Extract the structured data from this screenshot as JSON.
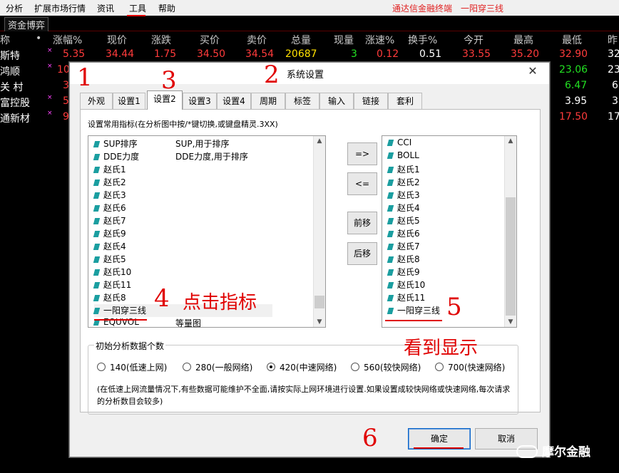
{
  "menu": {
    "items": [
      "分析",
      "扩展市场行情",
      "资讯",
      "工具",
      "帮助"
    ],
    "brand": "通达信金融终端",
    "brand2": "一阳穿三线"
  },
  "tabs": {
    "quote_tab": "资金博弈"
  },
  "quote": {
    "headers": [
      "称",
      "•",
      "涨幅%",
      "现价",
      "涨跌",
      "买价",
      "卖价",
      "总量",
      "现量",
      "涨速%",
      "换手%",
      "今开",
      "最高",
      "最低",
      "昨"
    ],
    "rows": [
      {
        "name": "斯特",
        "mark": "×",
        "chg": "5.35",
        "price": "34.44",
        "diff": "1.75",
        "bid": "34.50",
        "ask": "34.54",
        "vol": "20687",
        "cur": "3",
        "speed": "0.12",
        "turn": "0.51",
        "open": "33.55",
        "high": "35.20",
        "low": "32.90",
        "prev": "32"
      },
      {
        "name": "鸿顺",
        "mark": "×",
        "chg": "10",
        "low": "23.06",
        "prev": "23"
      },
      {
        "name": "关 村",
        "mark": "",
        "chg": "3",
        "low": "6.47",
        "prev": "6"
      },
      {
        "name": "富控股",
        "mark": "×",
        "chg": "5",
        "low": "3.95",
        "prev": "3"
      },
      {
        "name": "通新材",
        "mark": "×",
        "chg": "9",
        "low": "17.50",
        "prev": "17"
      }
    ]
  },
  "dialog": {
    "title": "系统设置",
    "close": "✕",
    "tabs": [
      "外观",
      "设置1",
      "设置2",
      "设置3",
      "设置4",
      "周期",
      "标签",
      "输入",
      "链接",
      "套利"
    ],
    "active_tab": "设置2",
    "hint": "设置常用指标(在分析图中按/*键切换,或键盘精灵.3XX)",
    "left_list": [
      {
        "name": "SUP排序",
        "desc": "SUP,用于排序"
      },
      {
        "name": "DDE力度",
        "desc": "DDE力度,用于排序"
      },
      {
        "name": "赵氏1",
        "desc": ""
      },
      {
        "name": "赵氏2",
        "desc": ""
      },
      {
        "name": "赵氏3",
        "desc": ""
      },
      {
        "name": "赵氏6",
        "desc": ""
      },
      {
        "name": "赵氏7",
        "desc": ""
      },
      {
        "name": "赵氏9",
        "desc": ""
      },
      {
        "name": "赵氏4",
        "desc": ""
      },
      {
        "name": "赵氏5",
        "desc": ""
      },
      {
        "name": "赵氏10",
        "desc": ""
      },
      {
        "name": "赵氏11",
        "desc": ""
      },
      {
        "name": "赵氏8",
        "desc": ""
      },
      {
        "name": "一阳穿三线",
        "desc": ""
      },
      {
        "name": "EQUVOL",
        "desc": "等量图"
      }
    ],
    "right_list": [
      "CCI",
      "BOLL",
      "赵氏1",
      "赵氏2",
      "赵氏3",
      "赵氏4",
      "赵氏5",
      "赵氏6",
      "赵氏7",
      "赵氏8",
      "赵氏9",
      "赵氏10",
      "赵氏11",
      "一阳穿三线"
    ],
    "mid_buttons": [
      "=>",
      "<=",
      "前移",
      "后移"
    ],
    "group_title": "初始分析数据个数",
    "radios": [
      {
        "label": "140(低速上网)",
        "checked": false
      },
      {
        "label": "280(一般网络)",
        "checked": false
      },
      {
        "label": "420(中速网络)",
        "checked": true
      },
      {
        "label": "560(较快网络)",
        "checked": false
      },
      {
        "label": "700(快速网络)",
        "checked": false
      }
    ],
    "note": "(在低速上网流量情况下,有些数据可能维护不全面,请按实际上网环境进行设置.如果设置成较快网络或快速网络,每次请求的分析数目会较多)",
    "ok": "确定",
    "cancel": "取消"
  },
  "annotations": {
    "n1": "1",
    "n2": "2",
    "n3": "3",
    "n4": "4",
    "n5": "5",
    "n6": "6",
    "t4": "点击指标",
    "t5": "看到显示"
  },
  "watermark": "摩尔金融"
}
